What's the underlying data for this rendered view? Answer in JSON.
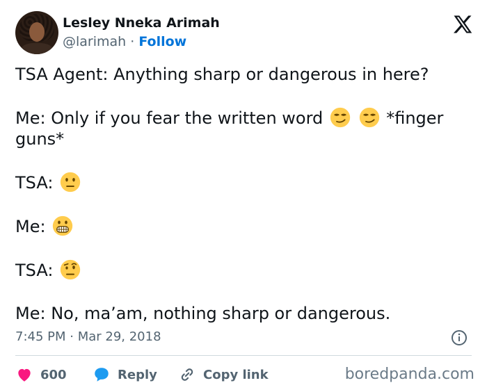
{
  "author": {
    "name": "Lesley Nneka Arimah",
    "handle": "@larimah",
    "separator": " · ",
    "follow_label": "Follow"
  },
  "tweet": {
    "lines": [
      "TSA Agent: Anything sharp or dangerous in here?",
      "Me: Only if you fear the written word",
      "*finger",
      "guns*",
      "TSA:",
      "Me:",
      "TSA:",
      "Me: No, ma’am, nothing sharp or dangerous."
    ],
    "emojis": [
      "smirking-face",
      "smirking-face",
      "neutral-face",
      "grimacing-face",
      "face-with-raised-eyebrow"
    ]
  },
  "meta": {
    "time": "7:45 PM",
    "separator": " · ",
    "date": "Mar 29, 2018"
  },
  "actions": {
    "likes_count": "600",
    "reply_label": "Reply",
    "copy_link_label": "Copy link"
  },
  "watermark": "boredpanda.com",
  "colors": {
    "like": "#f91880",
    "reply": "#1d9bf0",
    "follow": "#0074d9",
    "muted": "#536471"
  }
}
